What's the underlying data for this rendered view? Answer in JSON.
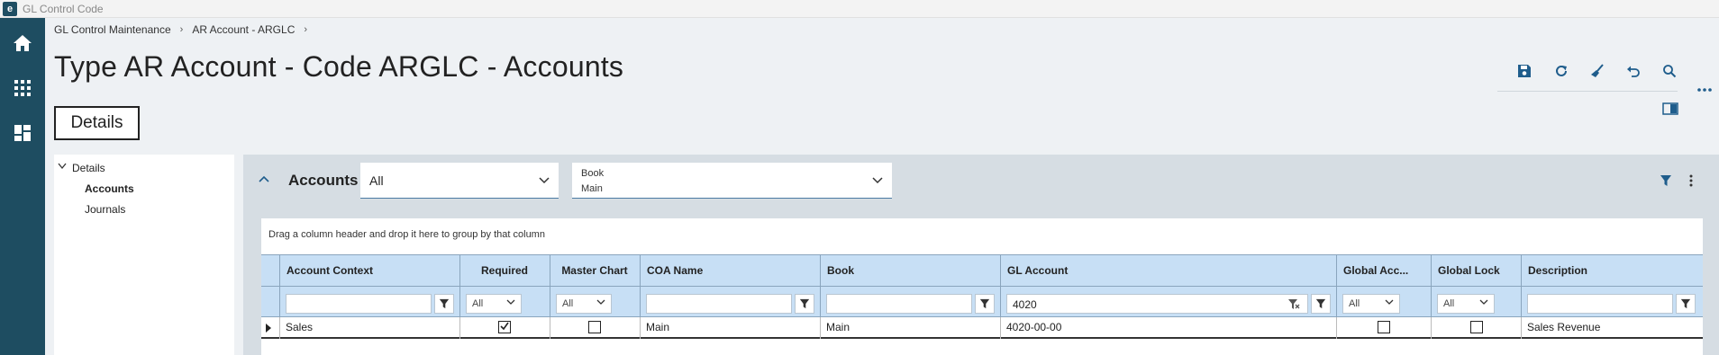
{
  "window": {
    "title": "GL Control Code"
  },
  "breadcrumb": [
    "GL Control Maintenance",
    "AR Account - ARGLC"
  ],
  "page_title": "Type AR Account - Code ARGLC - Accounts",
  "tabs": {
    "details": "Details"
  },
  "tree": {
    "root": "Details",
    "items": [
      "Accounts",
      "Journals"
    ]
  },
  "accounts_panel": {
    "title": "Accounts",
    "filter_dropdown": "All",
    "book_label": "Book",
    "book_value": "Main"
  },
  "grid": {
    "group_hint": "Drag a column header and drop it here to group by that column",
    "columns": [
      "Account Context",
      "Required",
      "Master Chart",
      "COA Name",
      "Book",
      "GL Account",
      "Global Acc...",
      "Global Lock",
      "Description"
    ],
    "filters": {
      "required": "All",
      "master_chart": "All",
      "gl_account": "4020",
      "global_acc": "All",
      "global_lock": "All"
    },
    "rows": [
      {
        "account_context": "Sales",
        "required": true,
        "master_chart": false,
        "coa_name": "Main",
        "book": "Main",
        "gl_account": "4020-00-00",
        "global_acc": false,
        "global_lock": false,
        "description": "Sales Revenue"
      }
    ]
  },
  "colors": {
    "rail": "#1e4d61",
    "grid_header": "#c7dff5",
    "accent": "#1f5d8c"
  }
}
